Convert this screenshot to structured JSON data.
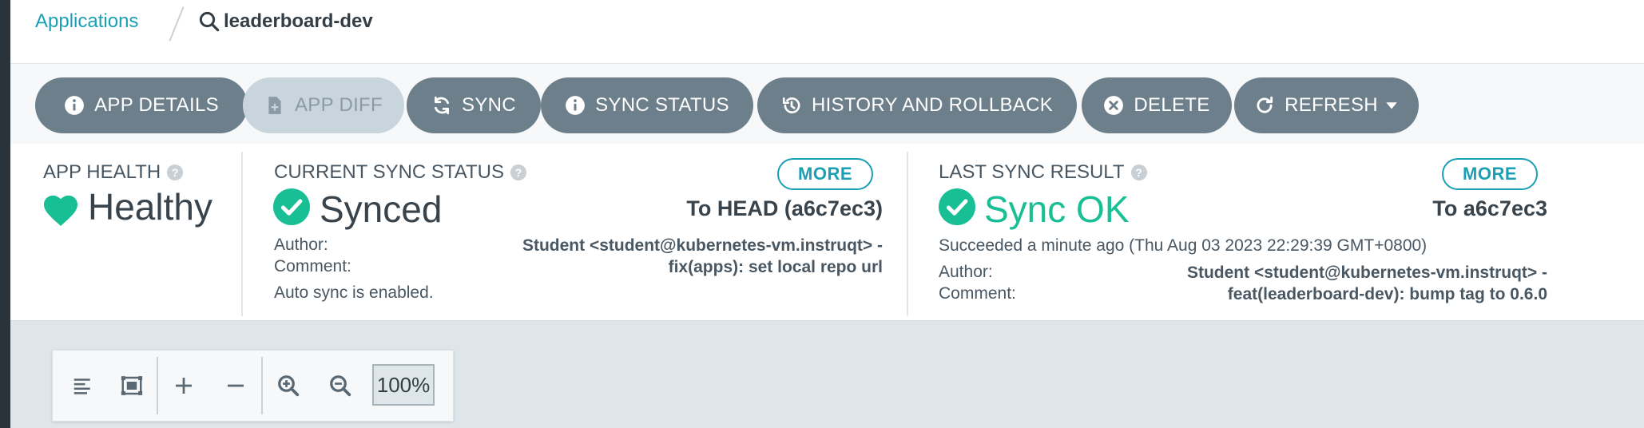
{
  "breadcrumb": {
    "parent": "Applications",
    "current": "leaderboard-dev"
  },
  "toolbar": {
    "app_details": "APP DETAILS",
    "app_diff": "APP DIFF",
    "sync": "SYNC",
    "sync_status": "SYNC STATUS",
    "history_rollback": "HISTORY AND ROLLBACK",
    "delete": "DELETE",
    "refresh": "REFRESH"
  },
  "health": {
    "label": "APP HEALTH",
    "value": "Healthy"
  },
  "sync_status": {
    "label": "CURRENT SYNC STATUS",
    "more": "MORE",
    "value": "Synced",
    "revision": "To HEAD (a6c7ec3)",
    "author_label": "Author:",
    "comment_label": "Comment:",
    "author_line": "Student <student@kubernetes-vm.instruqt> -",
    "comment_line": "fix(apps): set local repo url",
    "auto_sync": "Auto sync is enabled."
  },
  "last_sync": {
    "label": "LAST SYNC RESULT",
    "more": "MORE",
    "value": "Sync OK",
    "revision": "To a6c7ec3",
    "succeeded": "Succeeded a minute ago (Thu Aug 03 2023 22:29:39 GMT+0800)",
    "author_label": "Author:",
    "comment_label": "Comment:",
    "author_line": "Student <student@kubernetes-vm.instruqt> -",
    "comment_line": "feat(leaderboard-dev): bump tag to 0.6.0"
  },
  "graph_toolbar": {
    "zoom_level": "100%"
  },
  "colors": {
    "accent": "#1aa0b4",
    "healthy": "#18be94",
    "button": "#6d7f8b",
    "button_disabled": "#c9d5dd",
    "background": "#dee6eb"
  },
  "icons": [
    "search-icon",
    "info-icon",
    "file-diff-icon",
    "sync-icon",
    "history-icon",
    "delete-circle-icon",
    "refresh-icon",
    "caret-down-icon",
    "help-icon",
    "heart-icon",
    "check-circle-icon",
    "align-left-icon",
    "fit-screen-icon",
    "plus-icon",
    "minus-icon",
    "zoom-in-icon",
    "zoom-out-icon"
  ]
}
